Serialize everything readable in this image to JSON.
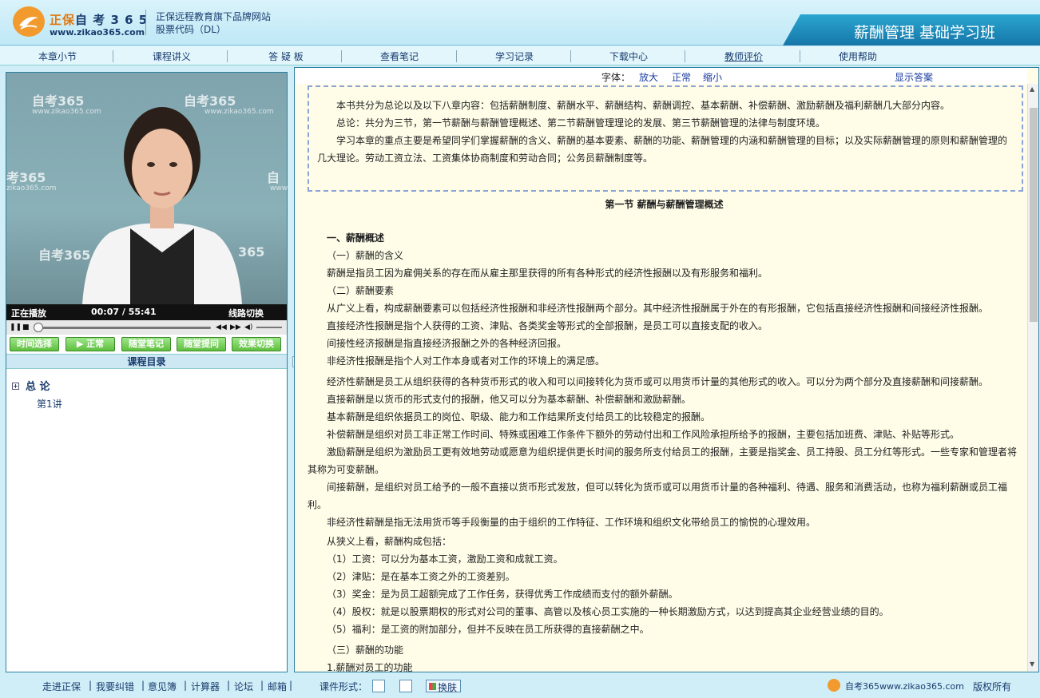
{
  "header": {
    "brand_a": "正保",
    "brand_b": "自 考 3 6 5",
    "site": "www.zikao365.com",
    "tagline1": "正保远程教育旗下品牌网站",
    "tagline2": "股票代码（DL）",
    "course_title": "薪酬管理 基础学习班"
  },
  "nav": [
    "本章小节",
    "课程讲义",
    "答 疑 板",
    "查看笔记",
    "学习记录",
    "下载中心",
    "教师评价",
    "使用帮助"
  ],
  "video": {
    "wm1": "自考365",
    "wm2": "自考365",
    "wm3": "考365",
    "wm4": "自",
    "wm5": "自考365",
    "wm6": "365",
    "wmsub1": "www.zikao365.com",
    "wmsub2": "www.zikao365.com",
    "wmsub3": "zikao365.com",
    "wmsub4": "www",
    "status": "正在播放",
    "time": "00:07  /  55:41",
    "switch": "线路切换"
  },
  "controls": [
    "时间选择",
    "▶ 正常",
    "随堂笔记",
    "随堂提问",
    "效果切换"
  ],
  "catalog": {
    "title": "课程目录",
    "chapter": "总  论",
    "lecture": "第1讲"
  },
  "fontbar": {
    "label": "字体：",
    "bigger": "放大",
    "normal": "正常",
    "smaller": "缩小",
    "answer": "显示答案"
  },
  "intro": [
    "本书共分为总论以及以下八章内容：包括薪酬制度、薪酬水平、薪酬结构、薪酬调控、基本薪酬、补偿薪酬、激励薪酬及福利薪酬几大部分内容。",
    "总论：共分为三节，第一节薪酬与薪酬管理概述、第二节薪酬管理理论的发展、第三节薪酬管理的法律与制度环境。",
    "学习本章的重点主要是希望同学们掌握薪酬的含义、薪酬的基本要素、薪酬的功能、薪酬管理的内涵和薪酬管理的目标；以及实际薪酬管理的原则和薪酬管理的几大理论。劳动工资立法、工资集体协商制度和劳动合同；公务员薪酬制度等。"
  ],
  "content": {
    "section_title": "第一节   薪酬与薪酬管理概述",
    "h1": "一、薪酬概述",
    "lines": [
      "（一）薪酬的含义",
      "薪酬是指员工因为雇佣关系的存在而从雇主那里获得的所有各种形式的经济性报酬以及有形服务和福利。",
      "（二）薪酬要素",
      "从广义上看，构成薪酬要素可以包括经济性报酬和非经济性报酬两个部分。其中经济性报酬属于外在的有形报酬，它包括直接经济性报酬和间接经济性报酬。",
      "直接经济性报酬是指个人获得的工资、津贴、各类奖金等形式的全部报酬，是员工可以直接支配的收入。",
      "间接性经济报酬是指直接经济报酬之外的各种经济回报。",
      "非经济性报酬是指个人对工作本身或者对工作的环境上的满足感。"
    ],
    "paras": [
      "经济性薪酬是员工从组织获得的各种货币形式的收入和可以间接转化为货币或可以用货币计量的其他形式的收入。可以分为两个部分及直接薪酬和间接薪酬。",
      "直接薪酬是以货币的形式支付的报酬，他又可以分为基本薪酬、补偿薪酬和激励薪酬。",
      "基本薪酬是组织依据员工的岗位、职级、能力和工作结果所支付给员工的比较稳定的报酬。",
      "补偿薪酬是组织对员工非正常工作时间、特殊或困难工作条件下额外的劳动付出和工作风险承担所给予的报酬，主要包括加班费、津贴、补贴等形式。",
      "激励薪酬是组织为激励员工更有效地劳动或愿意为组织提供更长时间的服务所支付给员工的报酬，主要是指奖金、员工持股、员工分红等形式。一些专家和管理者将其称为可变薪酬。",
      "间接薪酬，是组织对员工给予的一般不直接以货币形式发放，但可以转化为货币或可以用货币计量的各种福利、待遇、服务和消费活动，也称为福利薪酬或员工福利。",
      "非经济性薪酬是指无法用货币等手段衡量的由于组织的工作特征、工作环境和组织文化带给员工的愉悦的心理效用。"
    ],
    "narrow_intro": "从狭义上看，薪酬构成包括：",
    "narrow": [
      "（1）工资：可以分为基本工资，激励工资和成就工资。",
      "（2）津贴：是在基本工资之外的工资差别。",
      "（3）奖金：是为员工超额完成了工作任务，获得优秀工作成绩而支付的额外薪酬。",
      "（4）股权：就是以股票期权的形式对公司的董事、高管以及核心员工实施的一种长期激励方式，以达到提高其企业经营业绩的目的。",
      "（5）福利：是工资的附加部分，但并不反映在员工所获得的直接薪酬之中。"
    ],
    "h3": "（三）薪酬的功能",
    "h3sub": "1.薪酬对员工的功能"
  },
  "footer": {
    "links": [
      "走进正保",
      "我要纠错",
      "意见簿",
      "计算器",
      "论坛",
      "邮箱"
    ],
    "form_label": "课件形式：",
    "skin": "换肤",
    "brand": "自考365www.zikao365.com",
    "copyright": "版权所有"
  }
}
